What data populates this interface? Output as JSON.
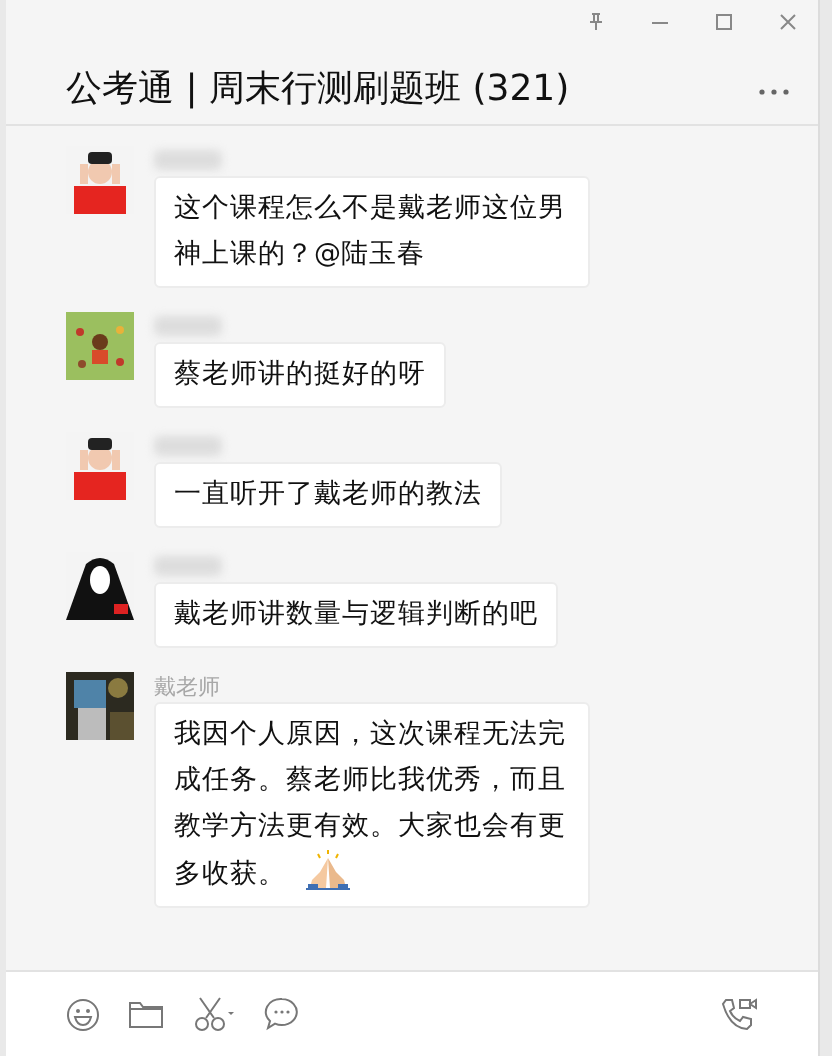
{
  "window": {
    "title": "公考通 | 周末行测刷题班 (321)"
  },
  "messages": [
    {
      "text": "这个课程怎么不是戴老师这位男神上课的？@陆玉春",
      "emoji": false
    },
    {
      "text": "蔡老师讲的挺好的呀",
      "emoji": false
    },
    {
      "text": "一直听开了戴老师的教法",
      "emoji": false
    },
    {
      "text": "戴老师讲数量与逻辑判断的吧",
      "emoji": false
    },
    {
      "sender": "戴老师",
      "text": "我因个人原因，这次课程无法完成任务。蔡老师比我优秀，而且教学方法更有效。大家也会有更多收获。",
      "emoji": true
    }
  ]
}
